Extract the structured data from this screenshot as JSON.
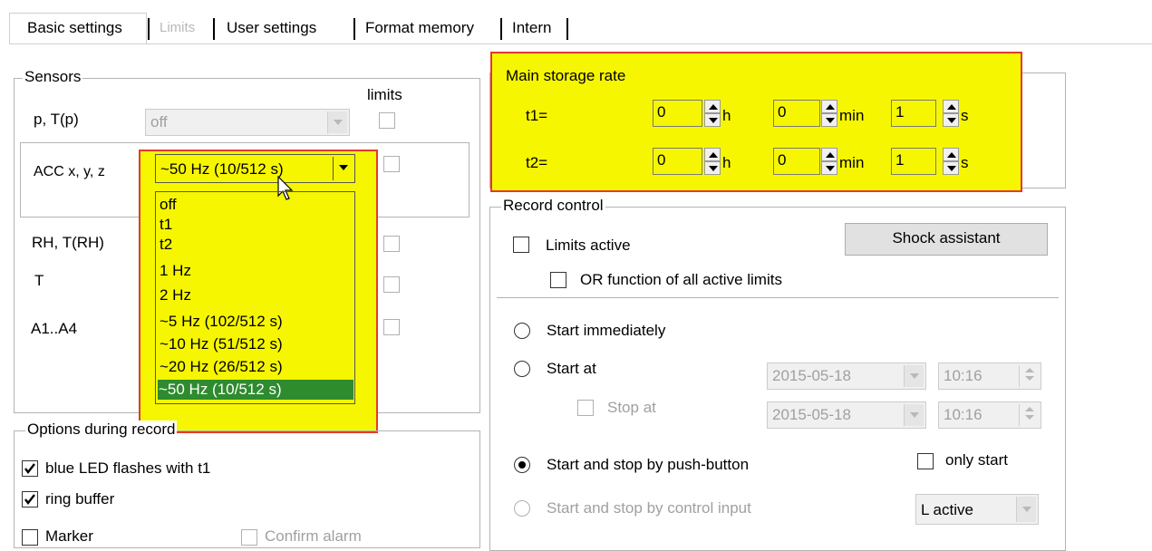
{
  "tabs": [
    {
      "label": "Basic settings",
      "disabled": false
    },
    {
      "label": "Limits",
      "disabled": true
    },
    {
      "label": "User settings",
      "disabled": false
    },
    {
      "label": "Format memory",
      "disabled": false
    },
    {
      "label": "Intern",
      "disabled": false
    }
  ],
  "sensors": {
    "title": "Sensors",
    "limits_header": "limits",
    "rows": [
      {
        "label": "p, T(p)",
        "value": "off"
      },
      {
        "label": "ACC x, y, z",
        "value": "~50 Hz (10/512 s)"
      },
      {
        "label": "RH, T(RH)"
      },
      {
        "label": "T"
      },
      {
        "label": "A1..A4"
      }
    ]
  },
  "acc_dropdown": {
    "options": [
      "off",
      "t1",
      "t2",
      "1 Hz",
      "2 Hz",
      "~5 Hz (102/512 s)",
      "~10 Hz (51/512 s)",
      "~20 Hz (26/512 s)",
      "~50 Hz (10/512 s)"
    ],
    "selected": "~50 Hz (10/512 s)"
  },
  "options_during_record": {
    "title": "Options during record",
    "blue_led": {
      "label": "blue LED flashes with t1",
      "checked": true
    },
    "ring_buffer": {
      "label": "ring buffer",
      "checked": true
    },
    "marker": {
      "label": "Marker",
      "checked": false
    },
    "confirm_alarm": {
      "label": "Confirm alarm",
      "checked": false
    }
  },
  "storage_rate": {
    "title": "Main storage rate",
    "rows": [
      {
        "label": "t1=",
        "h": "0",
        "min": "0",
        "s": "1"
      },
      {
        "label": "t2=",
        "h": "0",
        "min": "0",
        "s": "1"
      }
    ],
    "unit_h": "h",
    "unit_min": "min",
    "unit_s": "s"
  },
  "record_control": {
    "title": "Record control",
    "limits_active": "Limits active",
    "or_function": "OR function of all active limits",
    "shock_assistant": "Shock assistant",
    "start_immediately": "Start immediately",
    "start_at": "Start at",
    "stop_at": "Stop at",
    "start_date": "2015-05-18",
    "start_time": "10:16",
    "stop_date": "2015-05-18",
    "stop_time": "10:16",
    "push_button": "Start and stop by push-button",
    "only_start": "only start",
    "control_input": "Start and stop by control input",
    "control_input_mode": "L active"
  },
  "colors": {
    "highlight": "#f6f600",
    "highlight_border": "#e43a2a",
    "selected_item": "#2e8b2e"
  }
}
